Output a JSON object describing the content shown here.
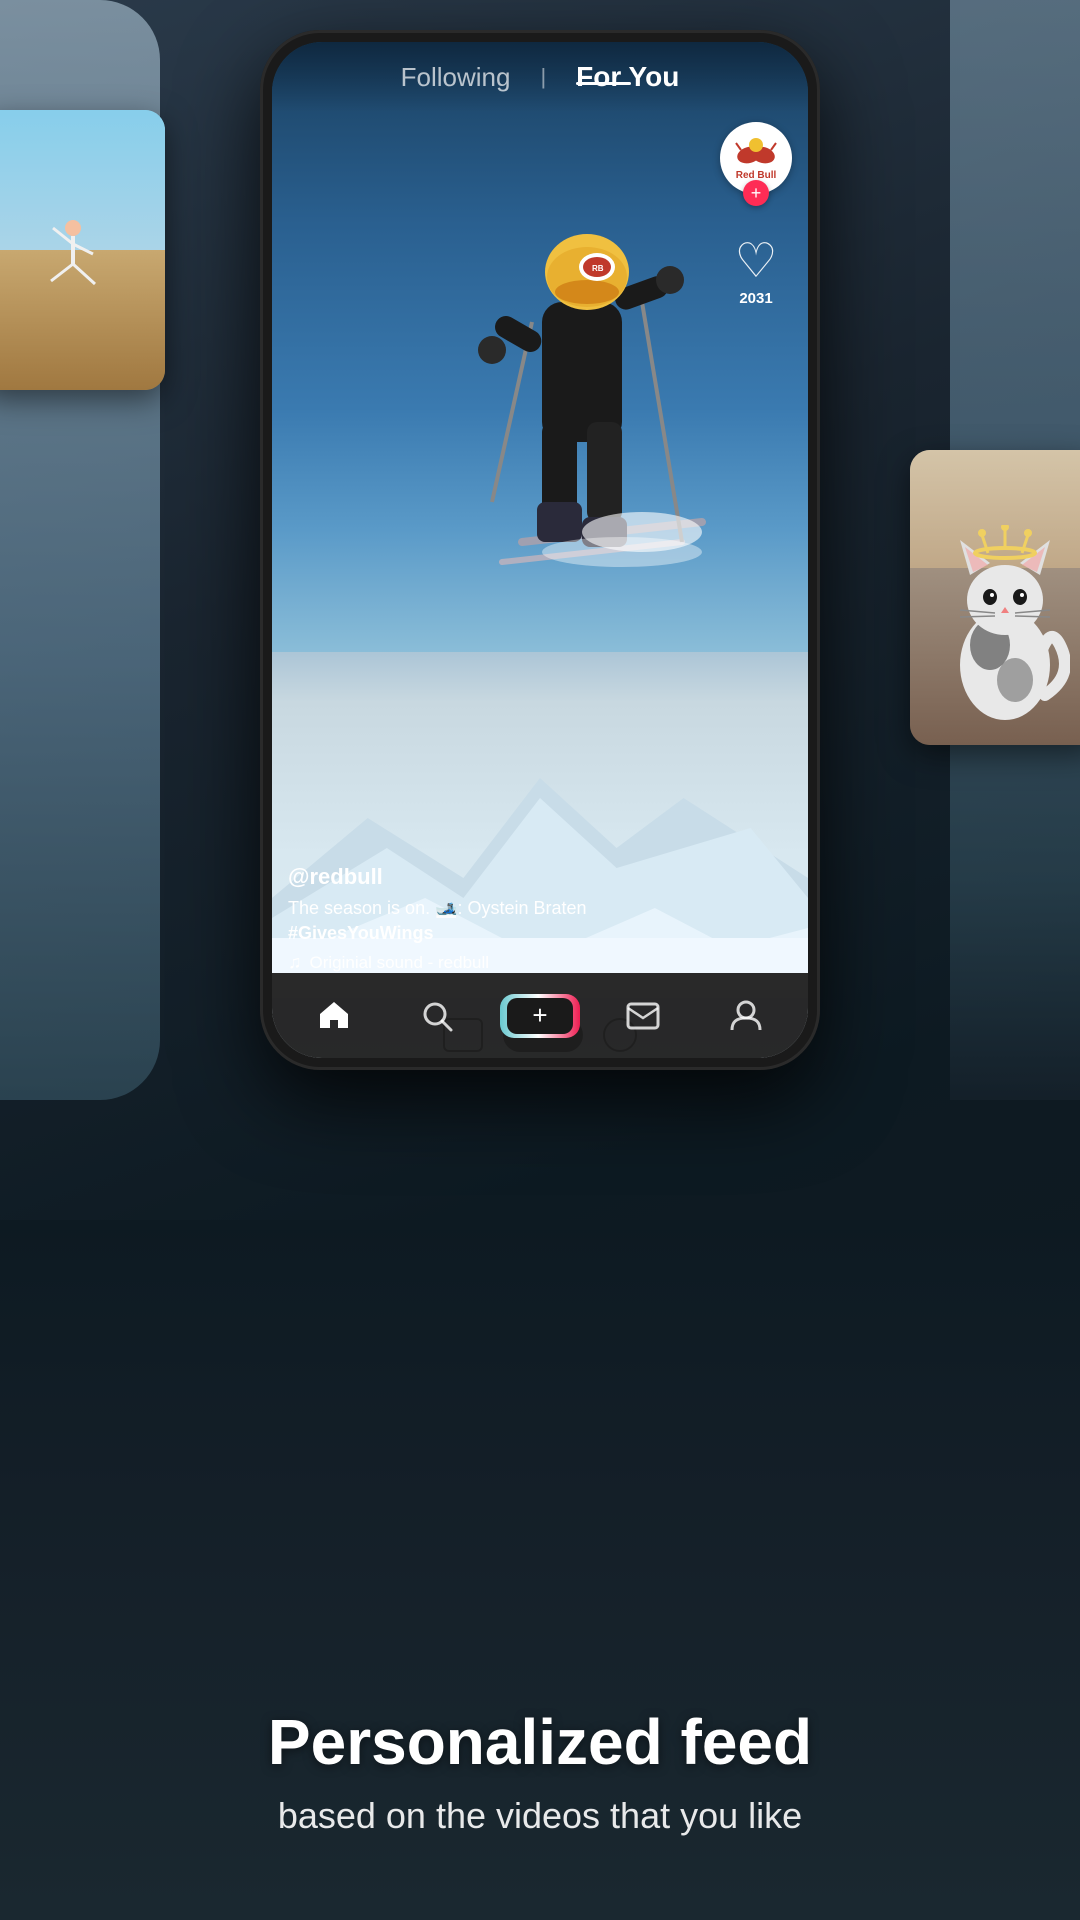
{
  "background": {
    "gradient_start": "#2a3a4a",
    "gradient_end": "#0d1a22"
  },
  "top_nav": {
    "following_label": "Following",
    "divider": "|",
    "for_you_label": "For You"
  },
  "video_content": {
    "username": "@redbull",
    "description": "The season is on. 🎿: Oystein Braten",
    "hashtag": "#GivesYouWings",
    "sound": "Originial sound - redbull"
  },
  "right_sidebar": {
    "profile_brand": "Red Bull",
    "follow_icon": "+",
    "heart_icon": "♡",
    "heart_count": "2031"
  },
  "bottom_nav": {
    "home_icon": "⌂",
    "search_icon": "○",
    "plus_icon": "+",
    "inbox_icon": "□",
    "profile_icon": "◯"
  },
  "bottom_text": {
    "headline": "Personalized feed",
    "subheadline": "based on the videos that you like"
  }
}
